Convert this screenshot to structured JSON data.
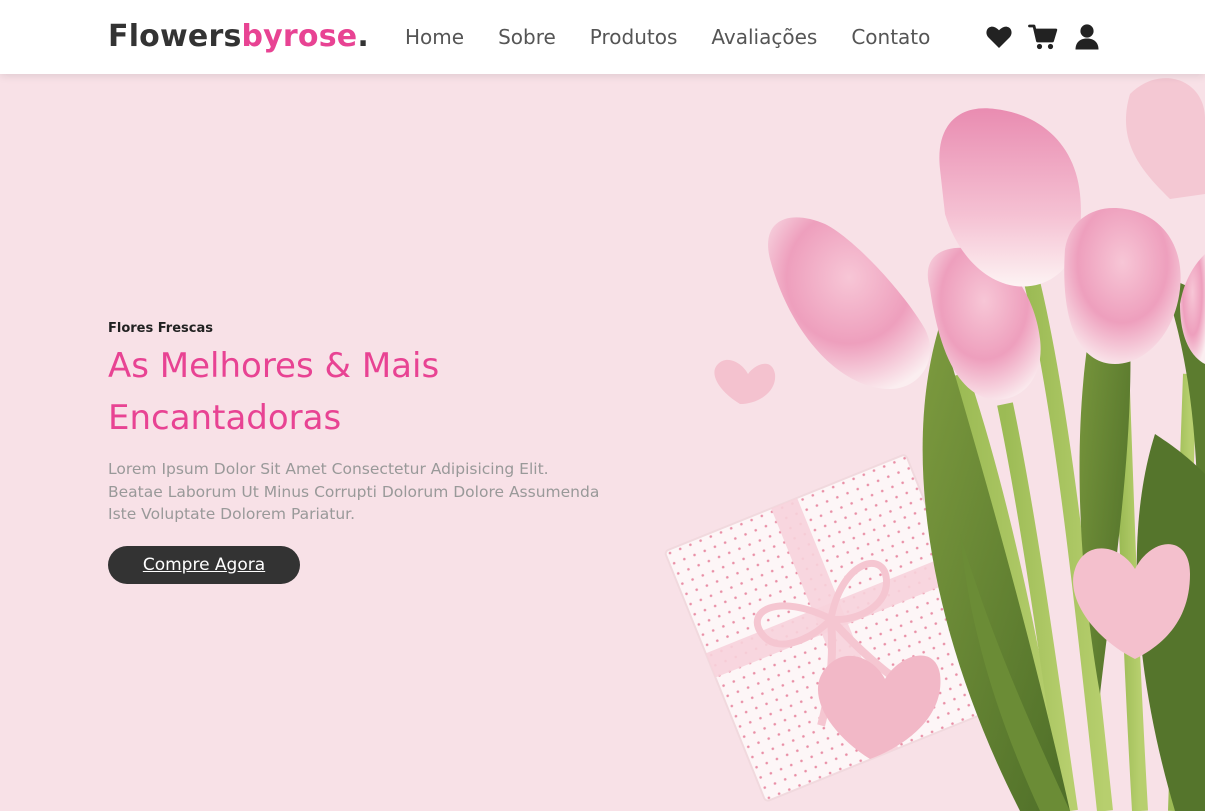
{
  "header": {
    "logo": {
      "main": "Flowers",
      "accent": "byrose",
      "dot": "."
    },
    "nav": [
      "Home",
      "Sobre",
      "Produtos",
      "Avaliações",
      "Contato"
    ],
    "icons": [
      "heart-icon",
      "cart-icon",
      "user-icon"
    ]
  },
  "hero": {
    "eyebrow": "Flores Frescas",
    "title_line1": "As Melhores & Mais",
    "title_line2": "Encantadoras",
    "description": "Lorem Ipsum Dolor Sit Amet Consectetur Adipisicing Elit. Beatae Laborum Ut Minus Corrupti Dolorum Dolore Assumenda Iste Voluptate Dolorem Pariatur.",
    "cta_label": "Compre Agora"
  },
  "colors": {
    "accent": "#e84393",
    "dark": "#333333",
    "hero_bg": "#f8e1e7",
    "muted_text": "#999999"
  }
}
